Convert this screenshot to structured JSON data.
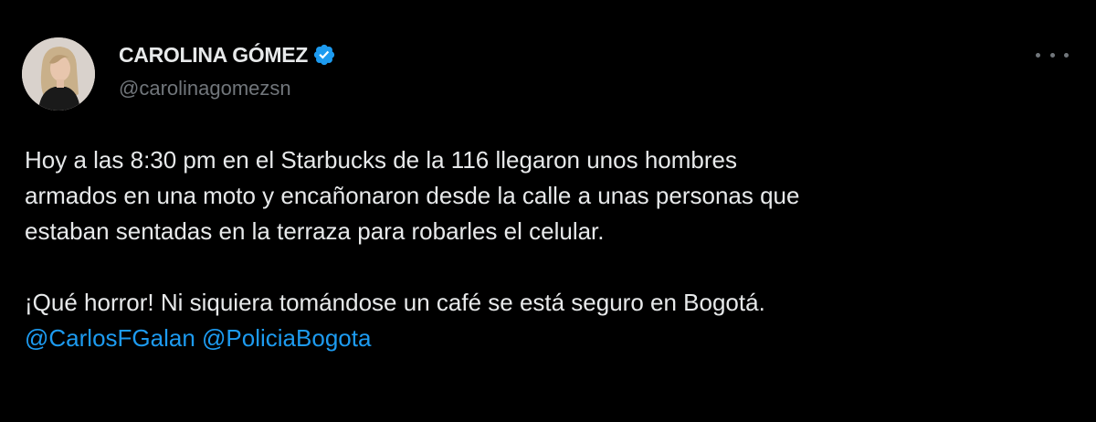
{
  "user": {
    "display_name": "CAROLINA GÓMEZ",
    "handle": "@carolinagomezsn",
    "verified": true,
    "verified_color": "#1d9bf0"
  },
  "tweet": {
    "paragraph1_lines": [
      "Hoy a las 8:30 pm en el Starbucks de la 116 llegaron unos hombres",
      "armados en una moto y encañonaron desde la calle a unas personas que",
      "estaban sentadas en la terraza para robarles el celular."
    ],
    "paragraph2_line": "¡Qué horror! Ni siquiera tomándose un café se está seguro en Bogotá.",
    "mentions": [
      "@CarlosFGalan",
      "@PoliciaBogota"
    ]
  },
  "icons": {
    "verified": "verified-badge-icon",
    "more": "more-options-icon"
  },
  "colors": {
    "background": "#000000",
    "text": "#e7e9ea",
    "secondary": "#71767b",
    "link": "#1d9bf0"
  }
}
